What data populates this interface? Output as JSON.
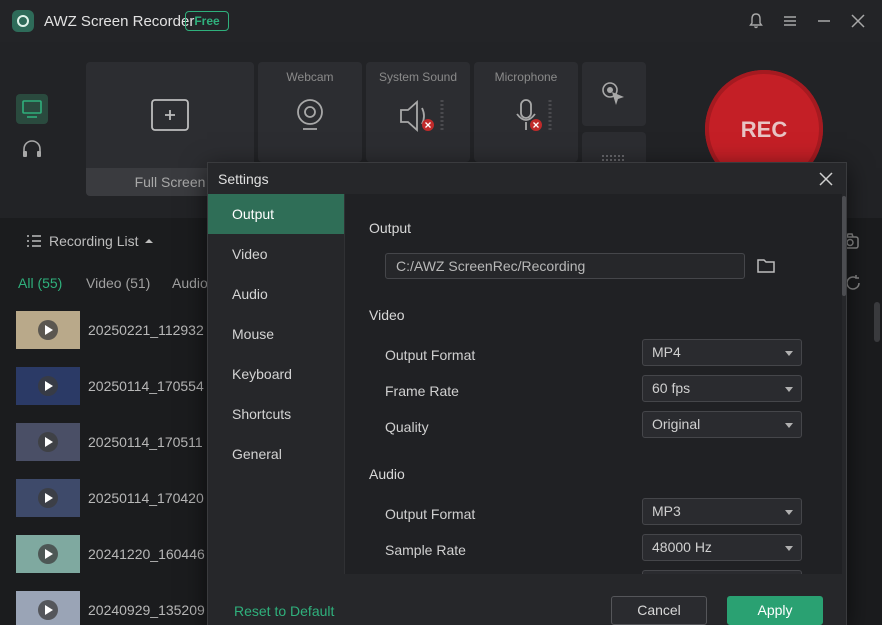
{
  "app": {
    "title": "AWZ Screen Recorder",
    "badge": "Free"
  },
  "capture": {
    "full_screen_label": "Full Screen",
    "webcam_label": "Webcam",
    "system_sound_label": "System Sound",
    "microphone_label": "Microphone",
    "rec_label": "REC"
  },
  "recordings": {
    "title": "Recording List",
    "tabs": [
      "All (55)",
      "Video (51)",
      "Audio"
    ],
    "items": [
      {
        "name": "20250221_112932"
      },
      {
        "name": "20250114_170554"
      },
      {
        "name": "20250114_170511"
      },
      {
        "name": "20250114_170420"
      },
      {
        "name": "20241220_160446"
      },
      {
        "name": "20240929_135209"
      }
    ]
  },
  "settings": {
    "title": "Settings",
    "nav": [
      "Output",
      "Video",
      "Audio",
      "Mouse",
      "Keyboard",
      "Shortcuts",
      "General"
    ],
    "output": {
      "section": "Output",
      "path": "C:/AWZ ScreenRec/Recording"
    },
    "video": {
      "section": "Video",
      "format_label": "Output Format",
      "format_value": "MP4",
      "framerate_label": "Frame Rate",
      "framerate_value": "60 fps",
      "quality_label": "Quality",
      "quality_value": "Original"
    },
    "audio": {
      "section": "Audio",
      "format_label": "Output Format",
      "format_value": "MP3",
      "samplerate_label": "Sample Rate",
      "samplerate_value": "48000 Hz"
    },
    "footer": {
      "reset": "Reset to Default",
      "cancel": "Cancel",
      "apply": "Apply"
    }
  },
  "colors": {
    "accent": "#2fb07c",
    "rec": "#c41f26",
    "nav_active": "#2f6e57"
  },
  "icons": [
    "app-logo-icon",
    "bell-icon",
    "menu-icon",
    "minimize-icon",
    "close-icon",
    "monitor-icon",
    "headphones-icon",
    "fullscreen-icon",
    "webcam-icon",
    "speaker-muted-icon",
    "mic-muted-icon",
    "cursor-click-icon",
    "keyboard-icon",
    "list-icon",
    "sort-up-icon",
    "camera-icon",
    "refresh-icon",
    "folder-icon"
  ]
}
